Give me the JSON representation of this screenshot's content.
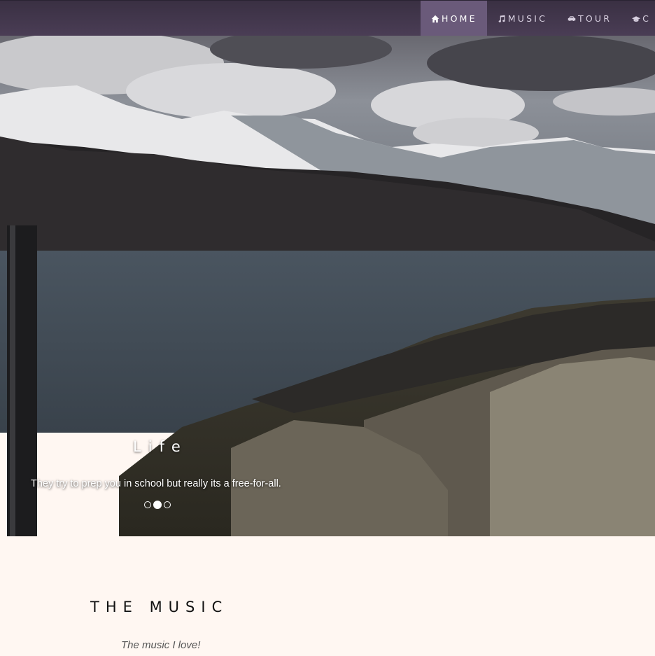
{
  "nav": {
    "items": [
      {
        "icon": "home-icon",
        "label": "HOME",
        "active": true
      },
      {
        "icon": "music-note-icon",
        "label": "MUSIC",
        "active": false
      },
      {
        "icon": "car-icon",
        "label": "TOUR",
        "active": false
      },
      {
        "icon": "graduation-cap-icon",
        "label": "C",
        "active": false
      }
    ],
    "background": "#3a3043",
    "active_background": "#6a5a7a"
  },
  "carousel": {
    "slide_title": "Life",
    "slide_caption": "They try to prep you in school but really its a free-for-all.",
    "indicator_count": 3,
    "active_index": 1
  },
  "music": {
    "heading": "THE MUSIC",
    "tagline": "The music I love!"
  }
}
